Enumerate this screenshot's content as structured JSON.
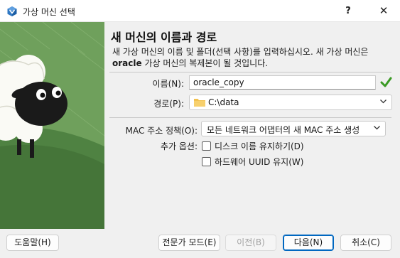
{
  "window": {
    "title": "가상 머신 선택",
    "help_label": "?",
    "close_label": "✕"
  },
  "page": {
    "heading": "새 머신의 이름과 경로",
    "desc_part1": "새 가상 머신의 이름 및 폴더(선택 사항)를 입력하십시오. 새 가상 머신은",
    "desc_bold": "oracle",
    "desc_part2": " 가상 머신의 복제본이 될 것입니다."
  },
  "form": {
    "name_label": "이름(N):",
    "name_value": "oracle_copy",
    "path_label": "경로(P):",
    "path_value": "C:\\data",
    "mac_label": "MAC 주소 정책(O):",
    "mac_value": "모든 네트워크 어댑터의 새 MAC 주소 생성",
    "extra_label": "추가 옵션:",
    "keep_disk_names": "디스크 이름 유지하기(D)",
    "keep_uuids": "하드웨어 UUID 유지(W)"
  },
  "buttons": {
    "help": "도움말(H)",
    "expert": "전문가 모드(E)",
    "back": "이전(B)",
    "next": "다음(N)",
    "cancel": "취소(C)"
  },
  "colors": {
    "sidebar_green": "#6fa05c",
    "sidebar_hill": "#4f8242",
    "valid_check": "#3a9a24",
    "folder": "#f2c14e",
    "accent": "#0067c0"
  }
}
